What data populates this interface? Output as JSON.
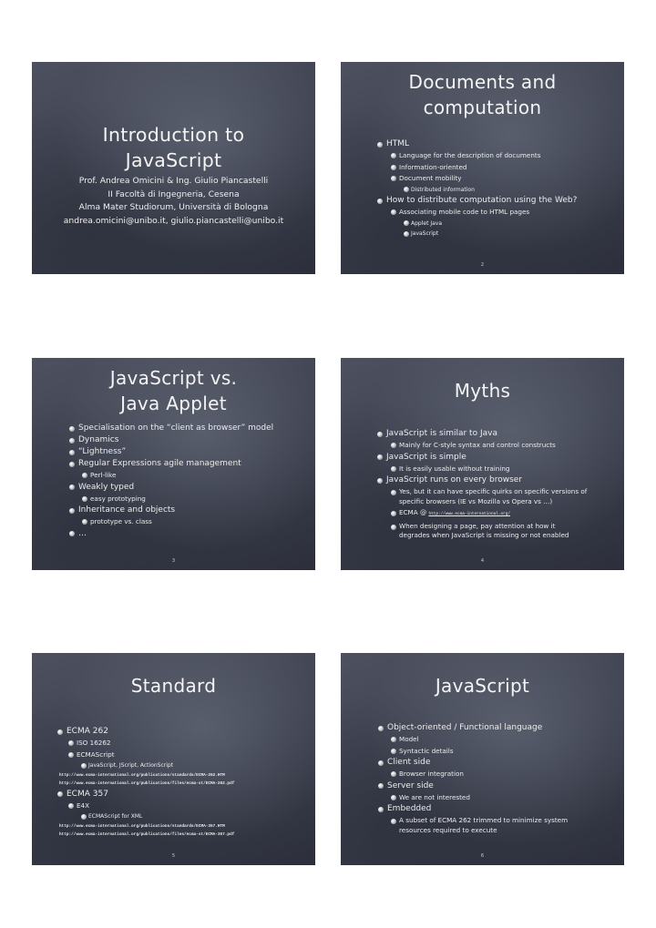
{
  "slides": [
    {
      "title_lines": [
        "Introduction to",
        "JavaScript"
      ],
      "subtitle_lines": [
        "Prof. Andrea Omicini & Ing. Giulio Piancastelli",
        "II Facoltà di Ingegneria, Cesena",
        "Alma Mater Studiorum, Università di Bologna",
        "andrea.omicini@unibo.it, giulio.piancastelli@unibo.it"
      ]
    },
    {
      "title_lines": [
        "Documents and",
        "computation"
      ],
      "page": "2",
      "bullets": [
        {
          "level": 1,
          "text": "HTML"
        },
        {
          "level": 2,
          "text": "Language for the description of documents"
        },
        {
          "level": 2,
          "text": "Information-oriented"
        },
        {
          "level": 2,
          "text": "Document mobility"
        },
        {
          "level": 3,
          "text": "Distributed information"
        },
        {
          "level": 1,
          "text": "How to distribute computation using the Web?"
        },
        {
          "level": 2,
          "text": "Associating mobile code to HTML pages"
        },
        {
          "level": 3,
          "text": "Applet Java"
        },
        {
          "level": 3,
          "text": "JavaScript"
        }
      ]
    },
    {
      "title_lines": [
        "JavaScript vs.",
        "Java Applet"
      ],
      "page": "3",
      "bullets": [
        {
          "level": 1,
          "text": "Specialisation on the “client as browser” model"
        },
        {
          "level": 1,
          "text": "Dynamics"
        },
        {
          "level": 1,
          "text": "“Lightness”"
        },
        {
          "level": 1,
          "text": "Regular Expressions agile management"
        },
        {
          "level": 2,
          "text": "Perl-like"
        },
        {
          "level": 1,
          "text": "Weakly typed"
        },
        {
          "level": 2,
          "text": "easy prototyping"
        },
        {
          "level": 1,
          "text": "Inheritance and objects"
        },
        {
          "level": 2,
          "text": "prototype vs. class"
        },
        {
          "level": 1,
          "text": "…"
        }
      ]
    },
    {
      "title_lines": [
        "Myths"
      ],
      "page": "4",
      "bullets": [
        {
          "level": 1,
          "text": "JavaScript is similar to Java"
        },
        {
          "level": 2,
          "text": "Mainly for C-style syntax and control constructs"
        },
        {
          "level": 1,
          "text": "JavaScript is simple"
        },
        {
          "level": 2,
          "text": "It is easily usable without training"
        },
        {
          "level": 1,
          "text": "JavaScript runs on every browser"
        },
        {
          "level": 2,
          "text": "Yes, but it can have specific quirks on specific versions of specific browsers (IE vs Mozilla vs Opera vs …)"
        },
        {
          "level": 2,
          "text": "ECMA @ ",
          "link": "http://www.ecma-international.org/"
        },
        {
          "level": 2,
          "text": "When designing a page, pay attention at how it degrades when JavaScript is missing or not enabled"
        }
      ]
    },
    {
      "title_lines": [
        "Standard"
      ],
      "page": "5",
      "bullets": [
        {
          "level": 1,
          "text": "ECMA 262"
        },
        {
          "level": 2,
          "text": "ISO 16262"
        },
        {
          "level": 2,
          "text": "ECMAScript"
        },
        {
          "level": 3,
          "text": "JavaScript, JScript, ActionScript"
        },
        {
          "level": 0,
          "text": "http://www.ecma-international.org/publications/standards/ECMA-262.HTM"
        },
        {
          "level": 0,
          "text": "http://www.ecma-international.org/publications/files/ecma-st/ECMA-262.pdf"
        },
        {
          "level": 1,
          "text": "ECMA 357"
        },
        {
          "level": 2,
          "text": "E4X"
        },
        {
          "level": 3,
          "text": "ECMAScript for XML"
        },
        {
          "level": 0,
          "text": "http://www.ecma-international.org/publications/standards/ECMA-357.HTM"
        },
        {
          "level": 0,
          "text": "http://www.ecma-international.org/publications/files/ecma-st/ECMA-357.pdf"
        }
      ]
    },
    {
      "title_lines": [
        "JavaScript"
      ],
      "page": "6",
      "bullets": [
        {
          "level": 1,
          "text": "Object-oriented / Functional language"
        },
        {
          "level": 2,
          "text": "Model"
        },
        {
          "level": 2,
          "text": "Syntactic details"
        },
        {
          "level": 1,
          "text": "Client side"
        },
        {
          "level": 2,
          "text": "Browser integration"
        },
        {
          "level": 1,
          "text": "Server side"
        },
        {
          "level": 2,
          "text": "We are not interested"
        },
        {
          "level": 1,
          "text": "Embedded"
        },
        {
          "level": 2,
          "text": "A subset of ECMA 262 trimmed to minimize system resources required to execute"
        }
      ]
    }
  ]
}
